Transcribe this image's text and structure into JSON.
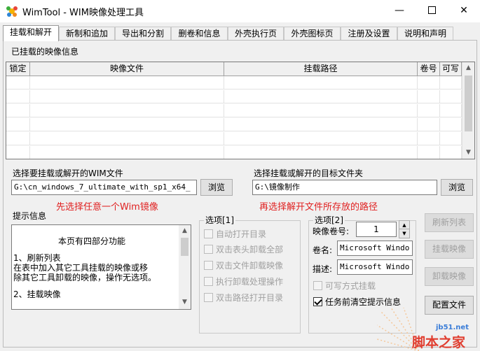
{
  "window": {
    "title": "WimTool - WIM映像处理工具",
    "minimize": "—",
    "close": "✕"
  },
  "tabs": [
    "挂载和解开",
    "新制和追加",
    "导出和分割",
    "删卷和信息",
    "外壳执行页",
    "外壳图标页",
    "注册及设置",
    "说明和声明"
  ],
  "mounted_group": {
    "label": "已挂载的映像信息",
    "columns": [
      "锁定",
      "映像文件",
      "挂载路径",
      "卷号",
      "可写"
    ]
  },
  "wim_file": {
    "label": "选择要挂载或解开的WIM文件",
    "value": "G:\\cn_windows_7_ultimate_with_sp1_x64_",
    "browse": "浏览"
  },
  "target_folder": {
    "label": "选择挂载或解开的目标文件夹",
    "value": "G:\\镜像制作",
    "browse": "浏览"
  },
  "hints": {
    "left": "先选择任意一个Wim镜像",
    "right": "再选择解开文件所存放的路径"
  },
  "info": {
    "label": "提示信息",
    "lines": [
      "本页有四部分功能",
      "1、刷新列表",
      "    在表中加入其它工具挂载的映像或移",
      "除其它工具卸载的映像，操作无选项。",
      "2、挂载映像"
    ]
  },
  "options1": {
    "label": "选项[1]",
    "items": [
      {
        "label": "自动打开目录",
        "checked": false,
        "enabled": false
      },
      {
        "label": "双击表头卸载全部",
        "checked": false,
        "enabled": false
      },
      {
        "label": "双击文件卸载映像",
        "checked": false,
        "enabled": false
      },
      {
        "label": "执行卸载处理操作",
        "checked": false,
        "enabled": false
      },
      {
        "label": "双击路径打开目录",
        "checked": false,
        "enabled": false
      }
    ]
  },
  "options2": {
    "label": "选项[2]",
    "volume_label": "映像卷号:",
    "volume_value": "1",
    "name_label": "卷名:",
    "name_value": "Microsoft Windo",
    "desc_label": "描述:",
    "desc_value": "Microsoft Windo",
    "writable": {
      "label": "可写方式挂载",
      "checked": false,
      "enabled": false
    },
    "clear_hint": {
      "label": "任务前清空提示信息",
      "checked": true,
      "enabled": true
    }
  },
  "actions": {
    "refresh": "刷新列表",
    "mount": "挂载映像",
    "unmount": "卸载映像",
    "config": "配置文件"
  },
  "watermark": {
    "site": "jb51.net",
    "name": "脚本之家"
  }
}
